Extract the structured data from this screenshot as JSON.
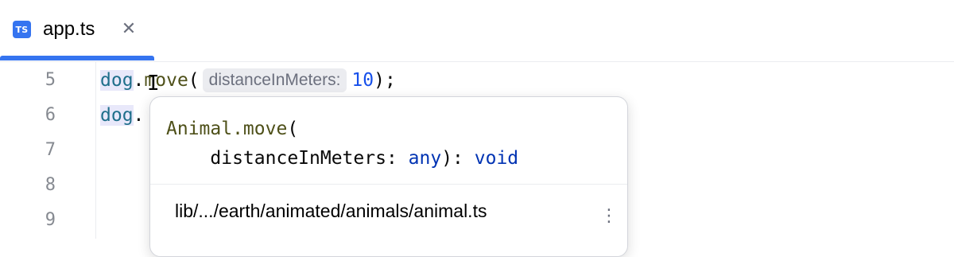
{
  "tab": {
    "icon_text": "TS",
    "label": "app.ts",
    "close_glyph": "✕"
  },
  "gutter": {
    "lines": [
      "5",
      "6",
      "7",
      "8",
      "9"
    ]
  },
  "code": {
    "line5": {
      "obj": "dog",
      "dot": ".",
      "method": "move",
      "open": "(",
      "inlay_hint": "distanceInMeters:",
      "arg": "10",
      "close": ");"
    },
    "line6": {
      "obj": "dog",
      "dot": "."
    }
  },
  "cursor_glyph": "I",
  "popup": {
    "sig_owner": "Animal.move",
    "sig_open": "(",
    "param_name": "    distanceInMeters",
    "colon": ": ",
    "param_type": "any",
    "return_sep": "): ",
    "return_type": "void",
    "path": "lib/.../earth/animated/animals/animal.ts",
    "more_glyph": "⋮"
  },
  "colors": {
    "accent": "#3574f0",
    "keyword": "#0033b3",
    "number": "#1750eb",
    "identifier": "#1f6f8b"
  },
  "icons": {
    "file_type": "typescript-file-icon",
    "close": "close-icon",
    "more": "more-vertical-icon"
  }
}
